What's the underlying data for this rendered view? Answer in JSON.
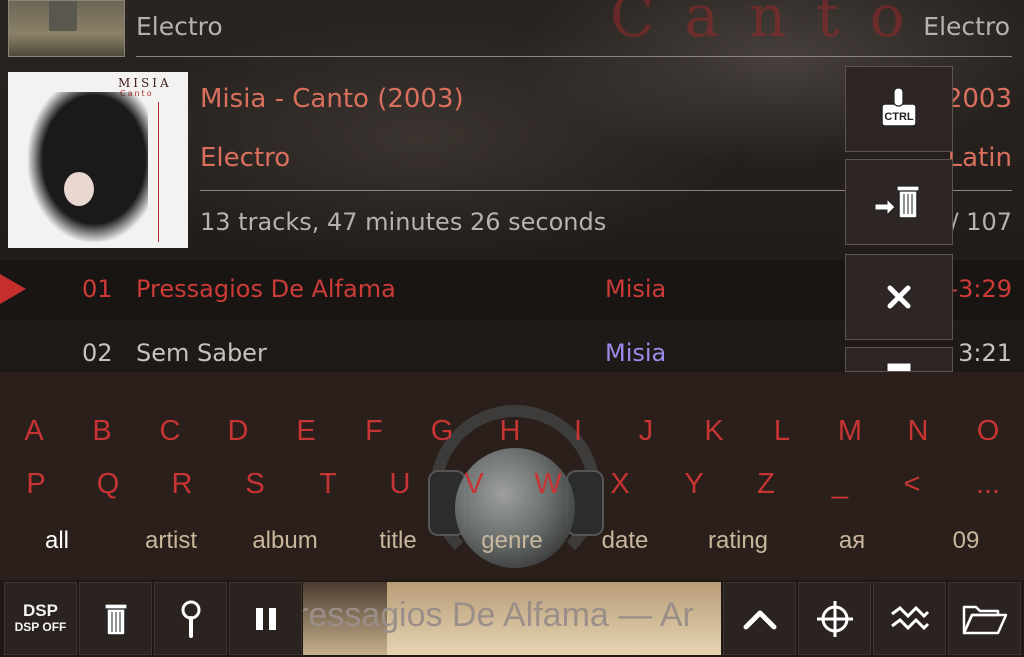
{
  "previous_album": {
    "genre": "Electro",
    "genre_right": "Electro"
  },
  "album": {
    "cover_title": "MISIA",
    "cover_subtitle": "Canto",
    "title": "Misia - Canto (2003)",
    "year": "2003",
    "genre": "Electro",
    "genre_right": "Latin",
    "info": "13 tracks, 47 minutes 26 seconds",
    "count_right": "/ 107"
  },
  "tracks": [
    {
      "num": "01",
      "title": "Pressagios De Alfama",
      "artist": "Misia",
      "duration": "-3:29",
      "active": true
    },
    {
      "num": "02",
      "title": "Sem Saber",
      "artist": "Misia",
      "duration": "3:21",
      "active": false
    }
  ],
  "side_menu": [
    {
      "label": "CTRL",
      "icon": "ctrl-hand-icon"
    },
    {
      "icon": "move-to-trash-icon"
    },
    {
      "icon": "close-icon"
    },
    {
      "icon": "image-icon"
    }
  ],
  "keyboard": {
    "row1": [
      "A",
      "B",
      "C",
      "D",
      "E",
      "F",
      "G",
      "H",
      "I",
      "J",
      "K",
      "L",
      "M",
      "N",
      "O"
    ],
    "row2": [
      "P",
      "Q",
      "R",
      "S",
      "T",
      "U",
      "V",
      "W",
      "X",
      "Y",
      "Z",
      "_",
      "<",
      "..."
    ],
    "filters": [
      "all",
      "artist",
      "album",
      "title",
      "genre",
      "date",
      "rating",
      "ая",
      "09"
    ],
    "selected_filter": "all"
  },
  "bottom_bar": {
    "dsp_label": "DSP",
    "dsp_sub": "DSP OFF",
    "ticker": "ressagios De Alfama — Ar"
  },
  "colors": {
    "accent": "#c63433",
    "artist_link": "#9b8bea",
    "filter": "#c8b79c"
  }
}
